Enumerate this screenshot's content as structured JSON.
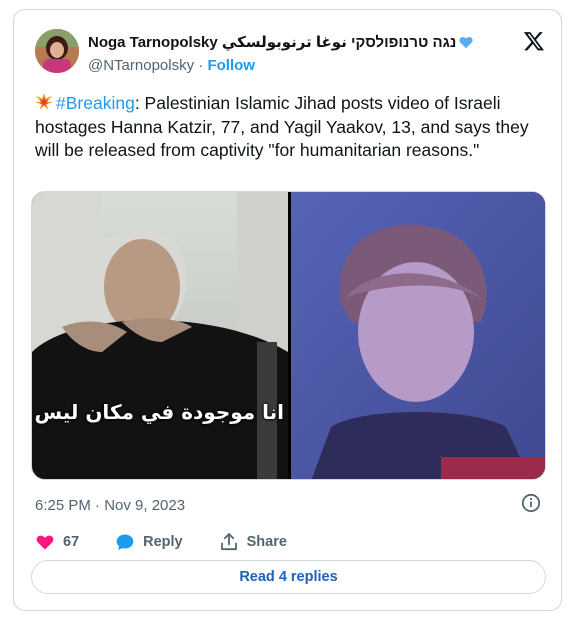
{
  "author": {
    "name": "Noga Tarnopolsky נגה טרנופולסקי نوغا ترنوبولسكي",
    "handle": "@NTarnopolsky",
    "follow_label": "Follow"
  },
  "tweet": {
    "hashtag": "#Breaking",
    "text_after_hashtag": ": Palestinian Islamic Jihad posts video of Israeli hostages Hanna Katzir, 77, and Yagil Yaakov, 13, and says they will be released from captivity \"for humanitarian reasons.\""
  },
  "media": {
    "left_caption": "انا موجودة في مكان ليس مكاني"
  },
  "timestamp": "6:25 PM · Nov 9, 2023",
  "actions": {
    "likes": "67",
    "reply_label": "Reply",
    "share_label": "Share"
  },
  "read_replies_label": "Read 4 replies",
  "colors": {
    "accent": "#1d9bf0",
    "like": "#f91880",
    "reply": "#1d9bf0"
  },
  "icons": [
    "x-logo-icon",
    "blue-heart-icon",
    "collision-emoji-icon",
    "info-icon",
    "heart-icon",
    "reply-bubble-icon",
    "share-icon"
  ]
}
